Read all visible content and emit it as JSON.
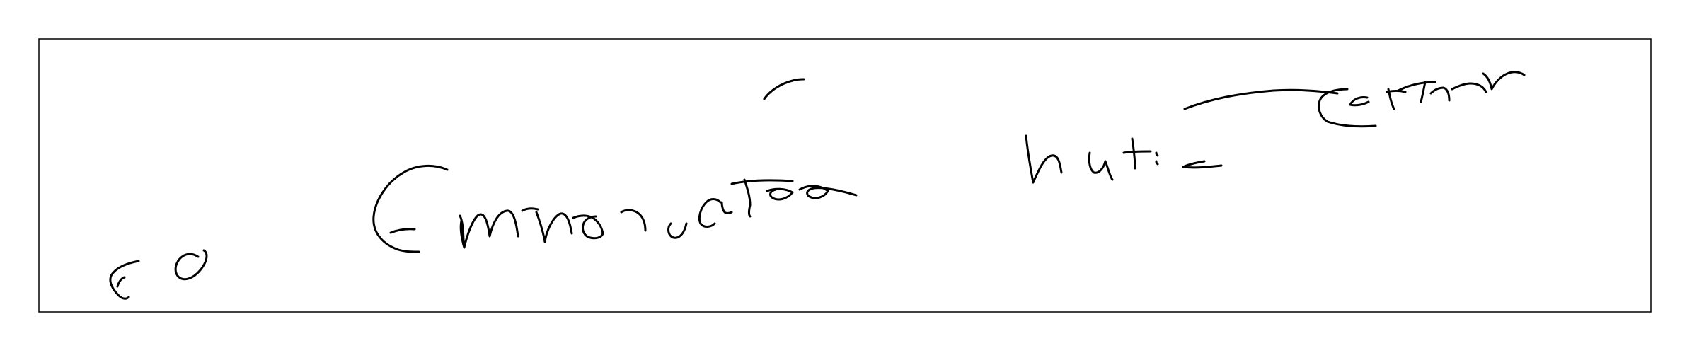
{
  "handwriting": {
    "ink_color": "#000000",
    "transcription": "so Emnendetee hut: cetilr",
    "words": [
      "so",
      "Emnendetee",
      "hut:",
      "cetilr"
    ]
  }
}
